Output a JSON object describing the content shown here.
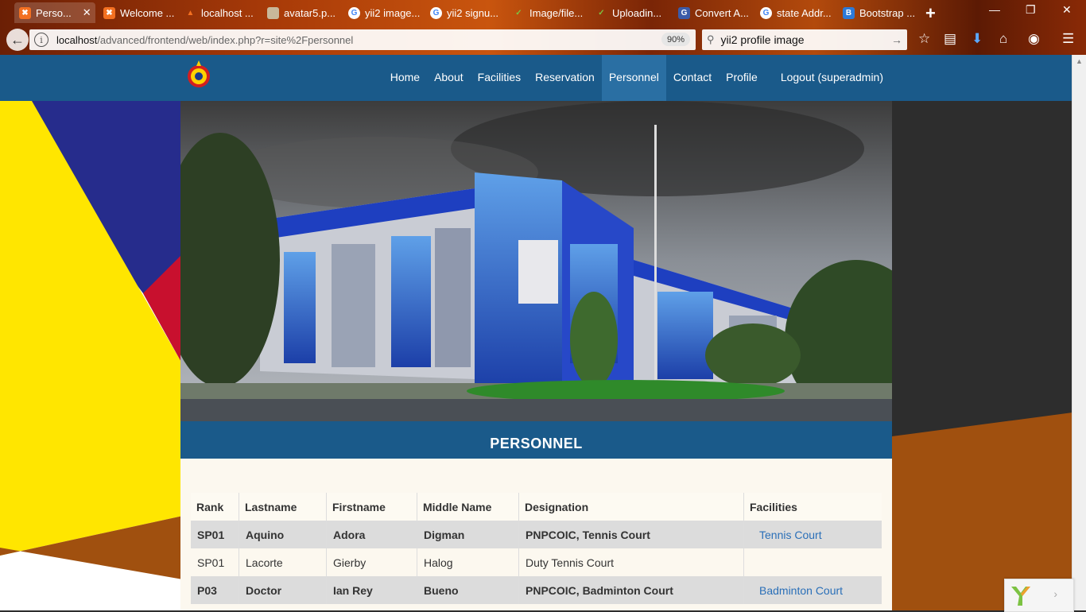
{
  "browser": {
    "tabs": [
      {
        "label": "Perso...",
        "icon": "xampp-icon",
        "active": true
      },
      {
        "label": "Welcome ...",
        "icon": "xampp-icon"
      },
      {
        "label": "localhost ...",
        "icon": "localhost-icon"
      },
      {
        "label": "avatar5.p...",
        "icon": "avatar-icon"
      },
      {
        "label": "yii2 image...",
        "icon": "google-icon"
      },
      {
        "label": "yii2 signu...",
        "icon": "google-icon"
      },
      {
        "label": "Image/file...",
        "icon": "yii-icon"
      },
      {
        "label": "Uploadin...",
        "icon": "yii-icon"
      },
      {
        "label": "Convert A...",
        "icon": "google-g-icon"
      },
      {
        "label": "state Addr...",
        "icon": "google-icon"
      },
      {
        "label": "Bootstrap ...",
        "icon": "bootstrap-icon"
      }
    ],
    "url_host": "localhost",
    "url_path": "/advanced/frontend/web/index.php?r=site%2Fpersonnel",
    "zoom": "90%",
    "search_query": "yii2 profile image"
  },
  "site": {
    "nav": [
      "Home",
      "About",
      "Facilities",
      "Reservation",
      "Personnel",
      "Contact",
      "Profile",
      "Logout (superadmin)"
    ],
    "active_nav": "Personnel",
    "page_title": "PERSONNEL",
    "brand_color": "#1a5a8a"
  },
  "personnel_table": {
    "headers": [
      "Rank",
      "Lastname",
      "Firstname",
      "Middle Name",
      "Designation",
      "Facilities"
    ],
    "rows": [
      {
        "rank": "SP01",
        "lastname": "Aquino",
        "firstname": "Adora",
        "middle": "Digman",
        "designation": "PNPCOIC, Tennis Court",
        "facility": "Tennis Court"
      },
      {
        "rank": "SP01",
        "lastname": "Lacorte",
        "firstname": "Gierby",
        "middle": "Halog",
        "designation": "Duty Tennis Court",
        "facility": ""
      },
      {
        "rank": "P03",
        "lastname": "Doctor",
        "firstname": "Ian Rey",
        "middle": "Bueno",
        "designation": "PNPCOIC, Badminton Court",
        "facility": "Badminton Court"
      }
    ]
  }
}
